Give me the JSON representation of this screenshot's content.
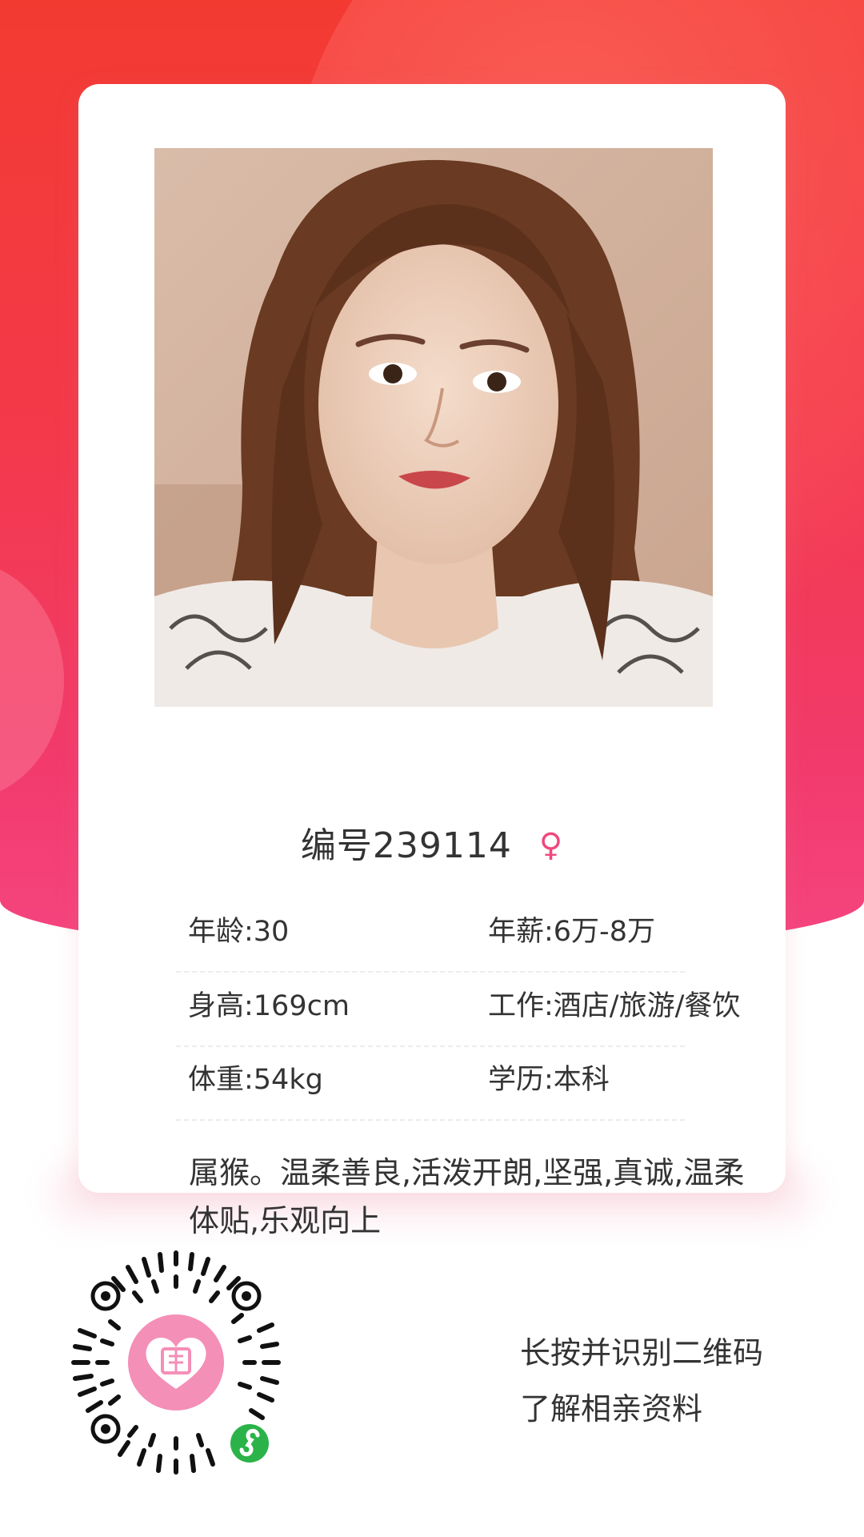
{
  "profile": {
    "id_label": "编号239114",
    "gender_symbol": "♀",
    "rows": [
      {
        "left": "年龄:30",
        "right": "年薪:6万-8万"
      },
      {
        "left": "身高:169cm",
        "right": "工作:酒店/旅游/餐饮"
      },
      {
        "left": "体重:54kg",
        "right": "学历:本科"
      }
    ],
    "description": "属猴。温柔善良,活泼开朗,坚强,真诚,温柔体贴,乐观向上"
  },
  "footer": {
    "line1": "长按并识别二维码",
    "line2": "了解相亲资料"
  },
  "colors": {
    "accent": "#f0487e",
    "hero_top": "#f33a31",
    "hero_bottom": "#f54580",
    "qr_badge": "#f48fb8",
    "miniprogram_badge": "#2bb34a"
  },
  "icons": {
    "gender": "female-icon",
    "qr": "qr-code-icon",
    "badge": "miniprogram-icon"
  }
}
